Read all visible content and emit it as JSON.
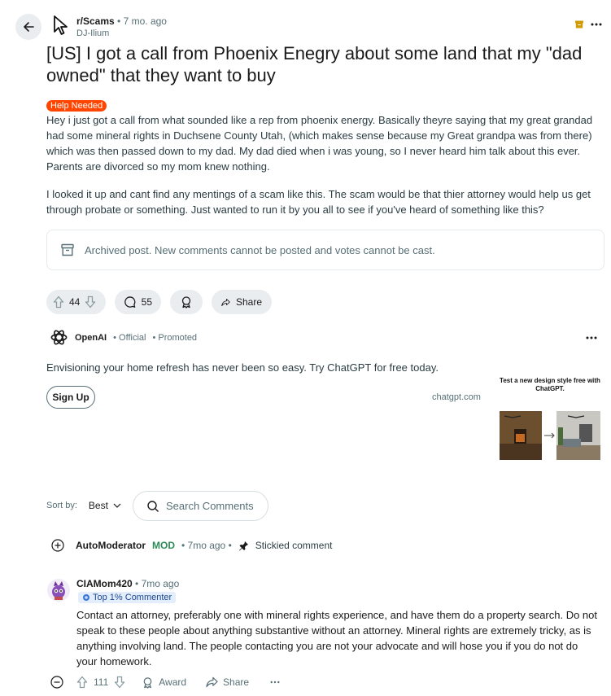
{
  "post": {
    "subreddit": "r/Scams",
    "separator": "•",
    "age": "7 mo. ago",
    "author": "DJ-Ilium",
    "title": "[US] I got a call from Phoenix Enegry about some land that my \"dad owned\" that they want to buy",
    "flair": "Help Needed",
    "body": [
      "Hey i just got a call from what sounded like a rep from phoenix energy. Basically theyre saying that my great grandad had some mineral rights in Duchsene County Utah, (which makes sense because my Great grandpa was from there) which was then passed down to my dad. My dad died when i was young, so I never heard him talk about this ever. Parents are divorced so my mom knew nothing.",
      "I looked it up and cant find any mentings of a scam like this. The scam would be that thier attorney would help us get through probate or something. Just wanted to run it by you all to see if you've heard of something like this?"
    ],
    "archived_notice": "Archived post. New comments cannot be posted and votes cannot be cast.",
    "votes": "44",
    "comments": "55",
    "share_label": "Share"
  },
  "promo": {
    "name": "OpenAI",
    "official": "• Official",
    "promoted": "• Promoted",
    "text": "Envisioning your home refresh has never been so easy. Try ChatGPT for free today.",
    "button": "Sign Up",
    "domain": "chatgpt.com",
    "ad_caption": "Test a new design style free with ChatGPT."
  },
  "comments_area": {
    "sort_label": "Sort by:",
    "sort_value": "Best",
    "search_placeholder": "Search Comments"
  },
  "comment1": {
    "author": "AutoModerator",
    "role": "MOD",
    "age": "• 7mo ago •",
    "stickied": "Stickied comment"
  },
  "comment2": {
    "author": "CIAMom420",
    "age": "• 7mo ago",
    "badge": "Top 1% Commenter",
    "text": "Contact an attorney, preferably one with mineral rights experience, and have them do a property search. Do not speak to these people about anything substantive without an attorney. Mineral rights are extremely tricky, as is anything involving land. The people contacting you are not your advocate and will hose you if you do not do your homework.",
    "votes": "111",
    "award": "Award",
    "share": "Share"
  },
  "colors": {
    "flair": "#ff4500",
    "mod": "#2e8b57",
    "pill": "#eaedef",
    "archive_icon": "#d09a00"
  }
}
